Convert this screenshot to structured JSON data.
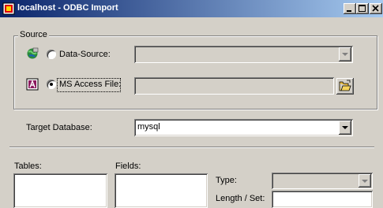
{
  "window": {
    "title": "localhost - ODBC Import",
    "minimize_icon": "minimize-icon",
    "maximize_icon": "maximize-icon",
    "close_icon": "close-icon"
  },
  "source_group": {
    "legend": "Source",
    "data_source": {
      "label": "Data-Source:",
      "selected": false,
      "icon": "odbc-globe-icon",
      "value": ""
    },
    "access_file": {
      "label": "MS Access File:",
      "selected": true,
      "icon": "access-file-icon",
      "value": "",
      "browse_icon": "open-folder-icon"
    }
  },
  "target": {
    "label": "Target Database:",
    "value": "mysql"
  },
  "tables": {
    "label": "Tables:"
  },
  "fields": {
    "label": "Fields:"
  },
  "type": {
    "label": "Type:",
    "value": ""
  },
  "length": {
    "label": "Length / Set:",
    "value": ""
  }
}
